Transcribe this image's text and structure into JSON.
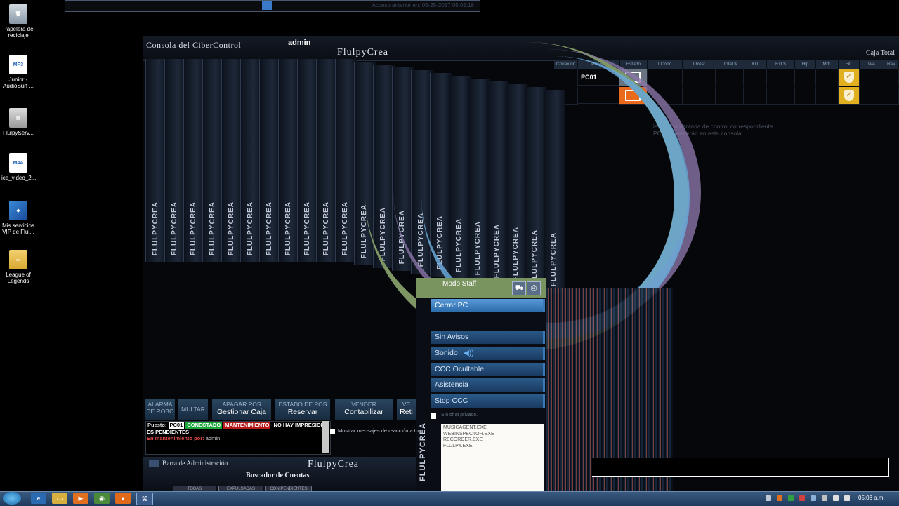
{
  "desktop": {
    "icons": [
      {
        "label": "Papelera de reciclaje",
        "glyph": "🗑"
      },
      {
        "label": "Junior - AudioSurf ...",
        "glyph": "MP3"
      },
      {
        "label": "FlulpyServ...",
        "glyph": "▦"
      },
      {
        "label": "ice_video_2...",
        "glyph": "M4A"
      },
      {
        "label": "Mis servicios VIP de Flul...",
        "glyph": "◆"
      },
      {
        "label": "League of Legends",
        "glyph": "▭"
      }
    ]
  },
  "top_strip": {
    "previous_access": "Acceso anterior en: 05-25-2017 05:05:18"
  },
  "console": {
    "title": "Consola del CiberControl",
    "user": "admin",
    "brand": "FlulpyCrea",
    "caja_total": "Caja Total"
  },
  "table": {
    "columns": [
      "Conexión",
      "Puesto",
      "Estado",
      "T.Conc.",
      "T.Rest.",
      "Total $",
      "KIT",
      "Ext $",
      "Hlp",
      "Mrk.",
      "Filt.",
      "WA",
      "Rev"
    ],
    "rows": [
      {
        "puesto": "PC01",
        "estado": "ok"
      },
      {
        "puesto": "",
        "estado": "orange"
      }
    ],
    "hint_line1": "ia abre la ventana de control correspondiente.",
    "hint_line2": "PCs, aparecerán en esta consola."
  },
  "trail_cards": {
    "brand": "FLULPYCREA"
  },
  "context_menu": {
    "header": "Modo Staff",
    "header_ghost": "Modo Staff",
    "items": [
      "Cerrar PC",
      "Sin Avisos",
      "Sonido",
      "CCC Ocultable",
      "Asistencia",
      "Stop CCC"
    ],
    "sound_icon": "◀))",
    "chat_label": "Sin chat privado.",
    "processes": [
      "MUSICAGENT.EXE",
      "WEBINSPECTOR.EXE",
      "RECORDER.EXE",
      "FLULPY.EXE"
    ],
    "side_brand": "FLULPYCREA"
  },
  "toolbar": {
    "alarma": [
      "ALARMA",
      "DE ROBO"
    ],
    "multar": "MULTAR",
    "apagar": {
      "top": "APAGAR POS",
      "main": "Gestionar Caja"
    },
    "estado": {
      "top": "ESTADO DE POS",
      "main": "Reservar"
    },
    "vender": {
      "top": "VENDER",
      "main": "Contabilizar"
    },
    "extra": {
      "top": "VE",
      "main": "Reti"
    }
  },
  "status": {
    "puesto_label": "Puesto:",
    "puesto": "PC01",
    "conectado": "CONECTADO",
    "mantenimiento": "MANTENIMIENTO",
    "no_impresion": "NO HAY IMPRESION",
    "pendientes": "ES PENDIENTES",
    "en_mant_label": "En mantenimiento por:",
    "en_mant_user": "admin",
    "mostrar": "Mostrar mensajes de reacción a tu"
  },
  "admin_bar": {
    "title": "Barra de Administración",
    "brand": "FlulpyCrea",
    "subtitle": "Buscador de Cuentas",
    "tabs": [
      "TODAS",
      "EXPULSADAS",
      "CON PENDIENTES"
    ]
  },
  "taskbar": {
    "clock": "05:08 a.m."
  }
}
